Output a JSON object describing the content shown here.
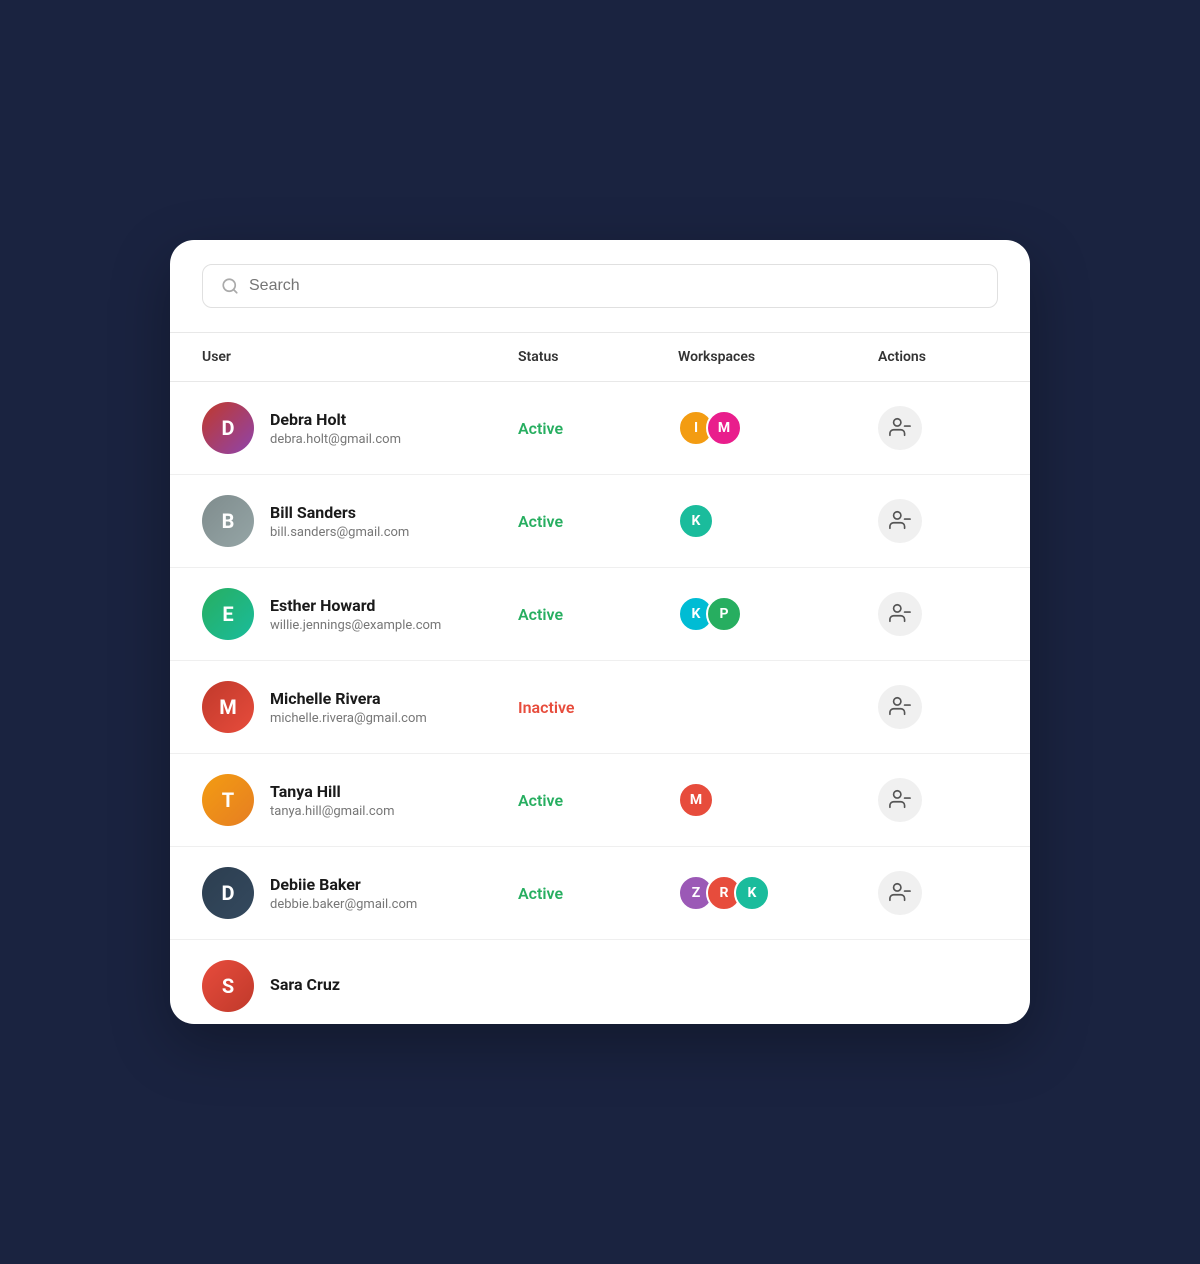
{
  "search": {
    "placeholder": "Search"
  },
  "table": {
    "headers": {
      "user": "User",
      "status": "Status",
      "workspaces": "Workspaces",
      "actions": "Actions"
    },
    "rows": [
      {
        "id": "debra-holt",
        "name": "Debra Holt",
        "email": "debra.holt@gmail.com",
        "avatar_initials": "D",
        "avatar_class": "avatar-debra",
        "status": "Active",
        "status_class": "status-active",
        "workspaces": [
          {
            "letter": "I",
            "color_class": "ws-orange"
          },
          {
            "letter": "M",
            "color_class": "ws-pink"
          }
        ]
      },
      {
        "id": "bill-sanders",
        "name": "Bill Sanders",
        "email": "bill.sanders@gmail.com",
        "avatar_initials": "B",
        "avatar_class": "avatar-bill",
        "status": "Active",
        "status_class": "status-active",
        "workspaces": [
          {
            "letter": "K",
            "color_class": "ws-teal"
          }
        ]
      },
      {
        "id": "esther-howard",
        "name": "Esther Howard",
        "email": "willie.jennings@example.com",
        "avatar_initials": "E",
        "avatar_class": "avatar-esther",
        "status": "Active",
        "status_class": "status-active",
        "workspaces": [
          {
            "letter": "K",
            "color_class": "ws-cyan"
          },
          {
            "letter": "P",
            "color_class": "ws-green"
          }
        ]
      },
      {
        "id": "michelle-rivera",
        "name": "Michelle Rivera",
        "email": "michelle.rivera@gmail.com",
        "avatar_initials": "M",
        "avatar_class": "avatar-michelle",
        "status": "Inactive",
        "status_class": "status-inactive",
        "workspaces": []
      },
      {
        "id": "tanya-hill",
        "name": "Tanya Hill",
        "email": "tanya.hill@gmail.com",
        "avatar_initials": "T",
        "avatar_class": "avatar-tanya",
        "status": "Active",
        "status_class": "status-active",
        "workspaces": [
          {
            "letter": "M",
            "color_class": "ws-coral"
          }
        ]
      },
      {
        "id": "debiie-baker",
        "name": "Debiie Baker",
        "email": "debbie.baker@gmail.com",
        "avatar_initials": "D",
        "avatar_class": "avatar-debiie",
        "status": "Active",
        "status_class": "status-active",
        "workspaces": [
          {
            "letter": "Z",
            "color_class": "ws-purple"
          },
          {
            "letter": "R",
            "color_class": "ws-red"
          },
          {
            "letter": "K",
            "color_class": "ws-teal"
          }
        ]
      },
      {
        "id": "sara-cruz",
        "name": "Sara Cruz",
        "email": "",
        "avatar_initials": "S",
        "avatar_class": "avatar-sara",
        "status": "",
        "status_class": "",
        "workspaces": [],
        "partial": true
      }
    ]
  }
}
